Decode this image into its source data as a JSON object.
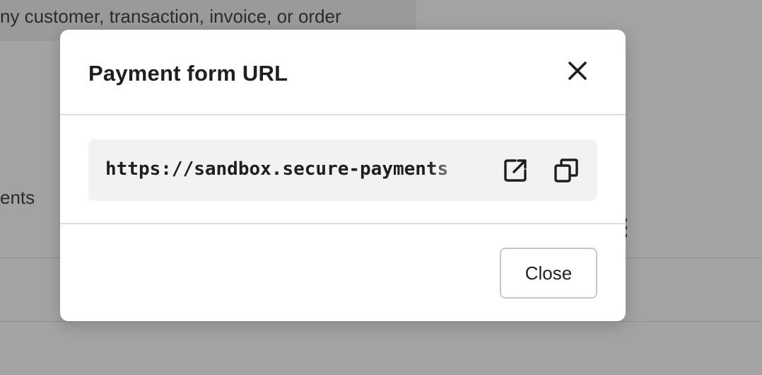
{
  "background": {
    "search_placeholder": "ny customer, transaction, invoice, or order",
    "side_fragment": "ents"
  },
  "modal": {
    "title": "Payment form URL",
    "url": "https://sandbox.secure-payments",
    "close_label": "Close",
    "icons": {
      "close": "close-icon",
      "open": "open-external-icon",
      "copy": "copy-icon"
    }
  }
}
